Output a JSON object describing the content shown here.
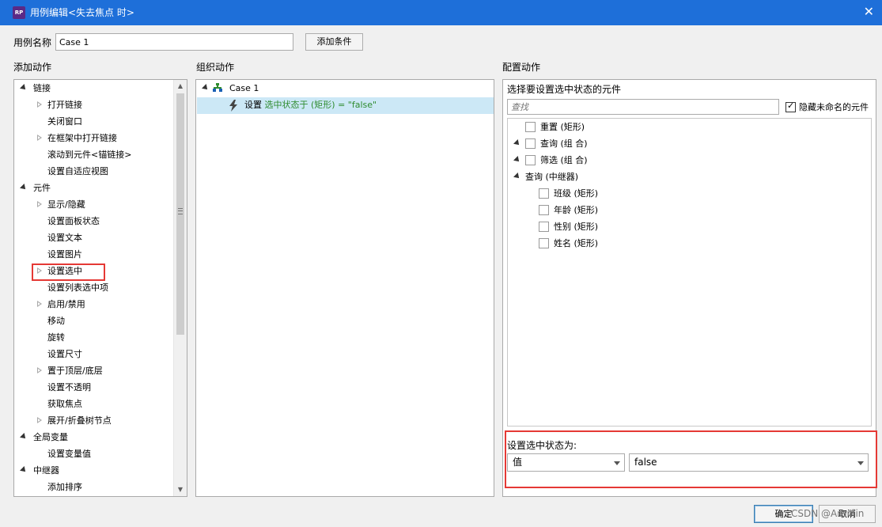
{
  "window": {
    "icon_text": "RP",
    "title": "用例编辑<失去焦点 时>",
    "close_glyph": "✕"
  },
  "case_name": {
    "label": "用例名称",
    "value": "Case 1",
    "add_condition_label": "添加条件"
  },
  "add_actions": {
    "header": "添加动作",
    "items": [
      {
        "label": "链接",
        "level": 0,
        "arrow": "open"
      },
      {
        "label": "打开链接",
        "level": 1,
        "arrow": "closed"
      },
      {
        "label": "关闭窗口",
        "level": 1,
        "arrow": "none"
      },
      {
        "label": "在框架中打开链接",
        "level": 1,
        "arrow": "closed"
      },
      {
        "label": "滚动到元件<锚链接>",
        "level": 1,
        "arrow": "none"
      },
      {
        "label": "设置自适应视图",
        "level": 1,
        "arrow": "none"
      },
      {
        "label": "元件",
        "level": 0,
        "arrow": "open"
      },
      {
        "label": "显示/隐藏",
        "level": 1,
        "arrow": "closed"
      },
      {
        "label": "设置面板状态",
        "level": 1,
        "arrow": "none"
      },
      {
        "label": "设置文本",
        "level": 1,
        "arrow": "none"
      },
      {
        "label": "设置图片",
        "level": 1,
        "arrow": "none"
      },
      {
        "label": "设置选中",
        "level": 1,
        "arrow": "closed"
      },
      {
        "label": "设置列表选中项",
        "level": 1,
        "arrow": "none"
      },
      {
        "label": "启用/禁用",
        "level": 1,
        "arrow": "closed"
      },
      {
        "label": "移动",
        "level": 1,
        "arrow": "none"
      },
      {
        "label": "旋转",
        "level": 1,
        "arrow": "none"
      },
      {
        "label": "设置尺寸",
        "level": 1,
        "arrow": "none"
      },
      {
        "label": "置于顶层/底层",
        "level": 1,
        "arrow": "closed"
      },
      {
        "label": "设置不透明",
        "level": 1,
        "arrow": "none"
      },
      {
        "label": "获取焦点",
        "level": 1,
        "arrow": "none"
      },
      {
        "label": "展开/折叠树节点",
        "level": 1,
        "arrow": "closed"
      },
      {
        "label": "全局变量",
        "level": 0,
        "arrow": "open"
      },
      {
        "label": "设置变量值",
        "level": 1,
        "arrow": "none"
      },
      {
        "label": "中继器",
        "level": 0,
        "arrow": "open"
      },
      {
        "label": "添加排序",
        "level": 1,
        "arrow": "none"
      }
    ]
  },
  "organize_actions": {
    "header": "组织动作",
    "case_label": "Case 1",
    "action_prefix": "设置 ",
    "action_detail": "选中状态于 (矩形) = \"false\""
  },
  "config_actions": {
    "header": "配置动作",
    "subheader": "选择要设置选中状态的元件",
    "search_placeholder": "查找",
    "hide_unnamed_label": "隐藏未命名的元件",
    "hide_unnamed_checked": true,
    "widgets": [
      {
        "label": "重置 (矩形)",
        "level": 0,
        "arrow": "none",
        "checkbox": true
      },
      {
        "label": "查询 (组 合)",
        "level": 0,
        "arrow": "open",
        "checkbox": true
      },
      {
        "label": "筛选 (组 合)",
        "level": 0,
        "arrow": "open",
        "checkbox": true
      },
      {
        "label": "查询 (中继器)",
        "level": 0,
        "arrow": "open",
        "checkbox": false
      },
      {
        "label": "班级 (矩形)",
        "level": 1,
        "arrow": "none",
        "checkbox": true
      },
      {
        "label": "年龄 (矩形)",
        "level": 1,
        "arrow": "none",
        "checkbox": true
      },
      {
        "label": "性别 (矩形)",
        "level": 1,
        "arrow": "none",
        "checkbox": true
      },
      {
        "label": "姓名 (矩形)",
        "level": 1,
        "arrow": "none",
        "checkbox": true
      }
    ],
    "set_state_label": "设置选中状态为:",
    "value_type": "值",
    "value": "false"
  },
  "footer": {
    "ok_label": "确定",
    "cancel_label": "取消",
    "watermark": "CSDN @Aranlin"
  },
  "colors": {
    "titlebar": "#1e6fd9",
    "highlight_red": "#e53935",
    "selected_row": "#cce8f6",
    "action_green": "#2e8b2e",
    "action_blue": "#1a5fb4"
  }
}
